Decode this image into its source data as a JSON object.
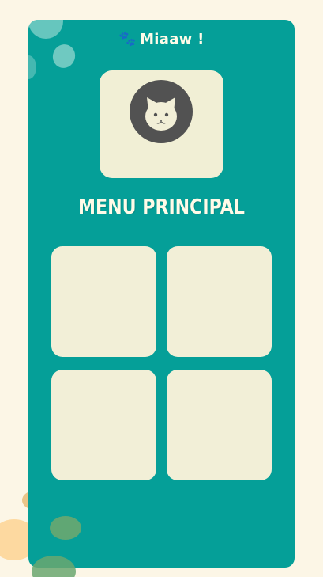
{
  "app": {
    "title": "Miaaw !",
    "title_icon": "paw-icon"
  },
  "profile": {
    "avatar_icon": "cat-face-icon"
  },
  "menu": {
    "heading": "MENU PRINCIPAL",
    "tiles": [
      {
        "label": ""
      },
      {
        "label": ""
      },
      {
        "label": ""
      },
      {
        "label": ""
      }
    ]
  },
  "colors": {
    "page_background": "#fcf6e6",
    "panel": "#059f98",
    "tile": "#f2efd7",
    "avatar_circle": "#525252",
    "text": "#fffbe8"
  }
}
